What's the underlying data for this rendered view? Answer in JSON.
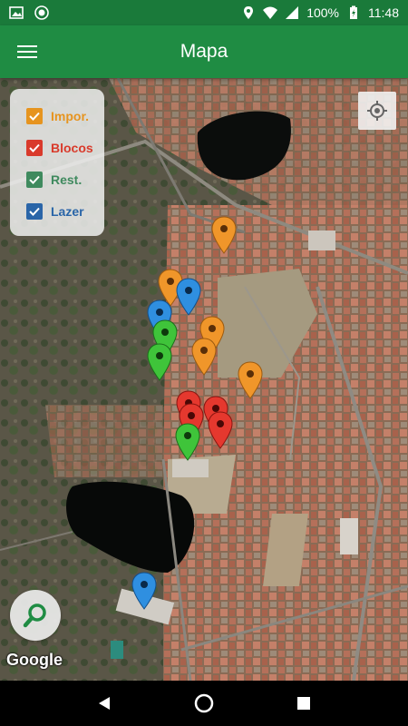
{
  "status_bar": {
    "battery": "100%",
    "time": "11:48",
    "icons": [
      "image-icon",
      "circle-app-icon",
      "location-icon",
      "wifi-icon",
      "signal-icon",
      "battery-charging-icon"
    ]
  },
  "app_bar": {
    "title": "Mapa",
    "menu_icon": "hamburger-menu-icon"
  },
  "legend": {
    "items": [
      {
        "label": "Impor.",
        "color": "#e6941f",
        "checked": true
      },
      {
        "label": "Blocos",
        "color": "#d93a2b",
        "checked": true
      },
      {
        "label": "Rest.",
        "color": "#3f8a5e",
        "checked": true
      },
      {
        "label": "Lazer",
        "color": "#2a65a8",
        "checked": true
      }
    ]
  },
  "map": {
    "attribution": "Google",
    "locate_icon": "my-location-icon",
    "search_icon": "search-icon",
    "marker_colors": {
      "important": "#f0962a",
      "blocks": "#e5382e",
      "restaurant": "#3fc43a",
      "leisure": "#2f8fe0"
    }
  },
  "nav_bar": {
    "icons": [
      "back-icon",
      "home-icon",
      "recents-icon"
    ]
  }
}
